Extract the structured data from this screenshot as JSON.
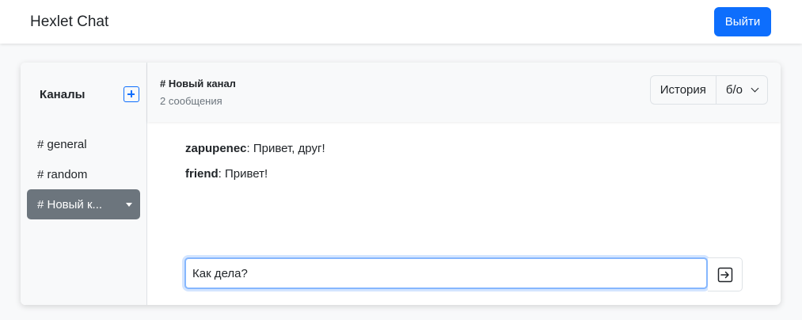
{
  "navbar": {
    "brand": "Hexlet Chat",
    "logout_label": "Выйти"
  },
  "sidebar": {
    "title": "Каналы",
    "add_icon": "plus-square-icon",
    "channels": [
      {
        "label": "# general",
        "active": false
      },
      {
        "label": "# random",
        "active": false
      },
      {
        "label": "# Новый к...",
        "active": true
      }
    ]
  },
  "chat": {
    "title": "# Новый канал",
    "count": "2 сообщения",
    "history_label": "История",
    "filter_label": "б/о",
    "messages": [
      {
        "user": "zapupenec",
        "text": ": Привет, друг!"
      },
      {
        "user": "friend",
        "text": ": Привет!"
      }
    ],
    "input": {
      "value": "Как дела?"
    },
    "send_icon": "arrow-right-square-icon"
  },
  "colors": {
    "primary": "#0d6efd",
    "active_channel": "#6c757d",
    "focus_border": "#86b7fe"
  }
}
